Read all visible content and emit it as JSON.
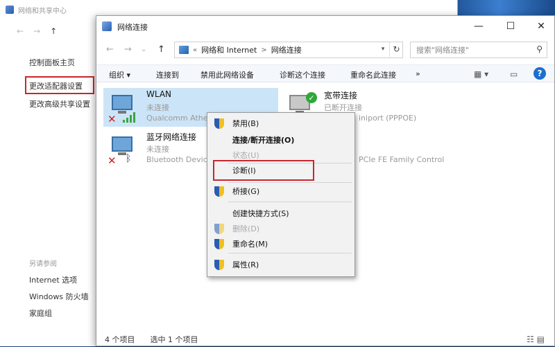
{
  "back_window": {
    "title": "网络和共享中心",
    "sidebar": {
      "links": [
        "控制面板主页",
        "更改适配器设置",
        "更改高级共享设置"
      ],
      "see_also_heading": "另请参阅",
      "see_also": [
        "Internet 选项",
        "Windows 防火墙",
        "家庭组"
      ]
    }
  },
  "window": {
    "title": "网络连接",
    "controls": {
      "minimize": "—",
      "maximize": "☐",
      "close": "✕"
    },
    "nav": {
      "back": "←",
      "forward": "→",
      "recent": "⌄",
      "up": "↑"
    },
    "address": {
      "prefix": "«",
      "crumbs": [
        "网络和 Internet",
        "网络连接"
      ],
      "separator": ">"
    },
    "search": {
      "placeholder": "搜索\"网络连接\""
    },
    "commands": [
      "组织 ▾",
      "连接到",
      "禁用此网络设备",
      "诊断这个连接",
      "重命名此连接",
      "»"
    ],
    "items": [
      {
        "name": "WLAN",
        "status": "未连接",
        "device": "Qualcomm Athe",
        "icon": "wifi-adapter-icon",
        "selected": true
      },
      {
        "name": "蓝牙网络连接",
        "status": "未连接",
        "device": "Bluetooth Devic",
        "icon": "bluetooth-adapter-icon",
        "selected": false
      },
      {
        "name": "宽带连接",
        "status": "已断开连接",
        "device": "iniport (PPPOE)",
        "icon": "broadband-adapter-icon",
        "selected": false
      },
      {
        "name": "",
        "status": "",
        "device": "PCIe FE Family Control",
        "icon": "ethernet-adapter-icon",
        "selected": false
      }
    ],
    "status_bar": {
      "count": "4 个项目",
      "selected": "选中 1 个项目"
    }
  },
  "context_menu": {
    "items": [
      {
        "label": "禁用(B)",
        "shield": true,
        "bold": false,
        "disabled": false
      },
      {
        "label": "连接/断开连接(O)",
        "shield": false,
        "bold": true,
        "disabled": false
      },
      {
        "label": "状态(U)",
        "shield": false,
        "bold": false,
        "disabled": true
      },
      {
        "label": "诊断(I)",
        "shield": false,
        "bold": false,
        "disabled": false
      },
      {
        "label": "桥接(G)",
        "shield": true,
        "bold": false,
        "disabled": false
      },
      {
        "label": "创建快捷方式(S)",
        "shield": false,
        "bold": false,
        "disabled": false
      },
      {
        "label": "删除(D)",
        "shield": true,
        "bold": false,
        "disabled": true
      },
      {
        "label": "重命名(M)",
        "shield": true,
        "bold": false,
        "disabled": false
      },
      {
        "label": "属性(R)",
        "shield": true,
        "bold": false,
        "disabled": false
      }
    ]
  },
  "colors": {
    "highlight_box": "#c8262d",
    "selection": "#cce4f7",
    "accent": "#1c6fd1"
  }
}
